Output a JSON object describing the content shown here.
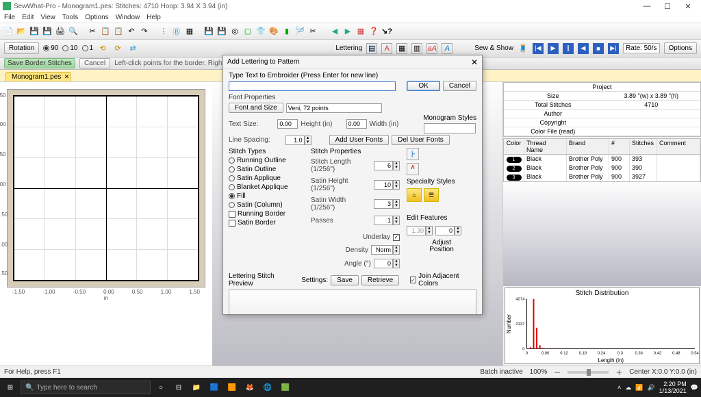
{
  "title": "SewWhat-Pro - Monogram1.pes:  Stitches: 4710  Hoop: 3.94 X 3.94 (in)",
  "menu": [
    "File",
    "Edit",
    "View",
    "Tools",
    "Options",
    "Window",
    "Help"
  ],
  "secondbar": {
    "rotation": "Rotation",
    "r90": "90",
    "r10": "10",
    "r1": "1",
    "lettering": "Lettering",
    "sewshow": "Sew & Show",
    "rate_label": "Rate:",
    "rate_value": "50/s",
    "options": "Options"
  },
  "thirdbar": {
    "save_border": "Save Border Stitches",
    "cancel": "Cancel",
    "hint": "Left-click points for the border. Right-click to remove previous"
  },
  "tab": {
    "name": "Monogram1.pes"
  },
  "canvas": {
    "ticks": [
      "-1.50",
      "-1.00",
      "-0.50",
      "0.00",
      "0.50",
      "1.00",
      "1.50"
    ],
    "unit": "in"
  },
  "project": {
    "header": "Project",
    "rows": [
      {
        "label": "Size",
        "value": "3.89 \"(w) x 3.89 \"(h)"
      },
      {
        "label": "Total Stitches",
        "value": "4710"
      },
      {
        "label": "Author",
        "value": ""
      },
      {
        "label": "Copyright",
        "value": ""
      },
      {
        "label": "Color File (read)",
        "value": ""
      }
    ]
  },
  "threads": {
    "headers": [
      "Color",
      "Thread Name",
      "Brand",
      "#",
      "Stitches",
      "Comment"
    ],
    "rows": [
      {
        "idx": "1",
        "name": "Black",
        "brand": "Brother Poly",
        "num": "900",
        "st": "393"
      },
      {
        "idx": "2",
        "name": "Black",
        "brand": "Brother Poly",
        "num": "900",
        "st": "390"
      },
      {
        "idx": "3",
        "name": "Black",
        "brand": "Brother Poly",
        "num": "900",
        "st": "3927"
      }
    ]
  },
  "chart_data": {
    "type": "bar",
    "title": "Stitch Distribution",
    "xlabel": "Length (in)",
    "ylabel": "Number",
    "x_ticks": [
      "0",
      "0.06",
      "0.12",
      "0.18",
      "0.24",
      "0.3",
      "0.36",
      "0.42",
      "0.48",
      "0.54"
    ],
    "y_ticks": [
      "0",
      "2137",
      "4274"
    ],
    "categories": [
      0.0,
      0.01,
      0.02,
      0.03,
      0.04,
      0.05,
      0.06,
      0.08
    ],
    "values": [
      50,
      120,
      4274,
      1800,
      300,
      60,
      30,
      15
    ],
    "xlim": [
      0,
      0.54
    ],
    "ylim": [
      0,
      4274
    ]
  },
  "status": {
    "help": "For Help, press F1",
    "batch": "Batch inactive",
    "zoom": "100%",
    "center": "Center X:0.0  Y:0.0 (in)"
  },
  "taskbar": {
    "search": "Type here to search",
    "time": "2:20 PM",
    "date": "1/13/2021"
  },
  "dialog": {
    "title": "Add Lettering to Pattern",
    "type_label": "Type Text to Embroider (Press Enter for new line)",
    "ok": "OK",
    "cancel": "Cancel",
    "font_props": "Font Properties",
    "font_and_size": "Font and Size",
    "font_value": "Veni, 72 points",
    "text_size": "Text Size:",
    "height_in": "Height (in)",
    "width_in": "Width (in)",
    "tsz_h": "0.00",
    "tsz_w": "0.00",
    "line_spacing": "Line Spacing:",
    "ls_val": "1.0",
    "add_user_fonts": "Add User Fonts",
    "del_user_fonts": "Del User Fonts",
    "mono_styles": "Monogram Styles",
    "stitch_types": "Stitch Types",
    "stypes": {
      "running": "Running Outline",
      "satinout": "Satin Outline",
      "satinapp": "Satin Applique",
      "blanket": "Blanket Applique",
      "fill": "Fill",
      "satincol": "Satin (Column)",
      "runborder": "Running Border",
      "satinborder": "Satin Border"
    },
    "stitch_props": "Stitch Properties",
    "sp_len": "Stitch Length (1/256\")",
    "sp_h": "Satin Height (1/256\")",
    "sp_w": "Satin Width (1/256\")",
    "sp_pass": "Passes",
    "sp_len_v": "6",
    "sp_h_v": "10",
    "sp_w_v": "3",
    "sp_pass_v": "1",
    "underlay": "Underlay",
    "density": "Density",
    "density_v": "Norm",
    "angle": "Angle (°)",
    "angle_v": "0",
    "spec_styles": "Specialty Styles",
    "edit_feat": "Edit Features",
    "ef1": "1.30",
    "ef2": "0",
    "adjust": "Adjust",
    "position": "Position",
    "preview": "Lettering Stitch Preview",
    "settings": "Settings:",
    "save": "Save",
    "retrieve": "Retrieve",
    "join": "Join Adjacent Colors"
  }
}
